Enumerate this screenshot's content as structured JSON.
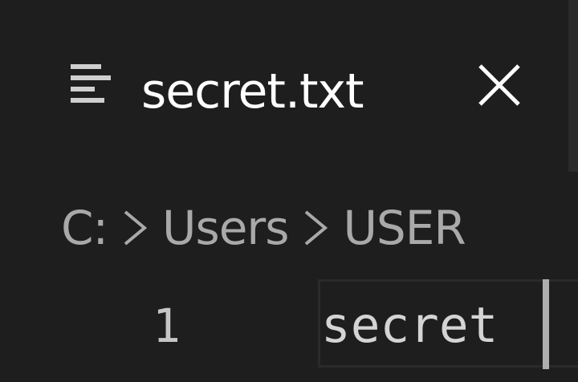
{
  "tab": {
    "icon": "file-lines-icon",
    "title": "secret.txt",
    "close_icon": "close-icon"
  },
  "breadcrumb": {
    "items": [
      "C:",
      "Users",
      "USER"
    ],
    "separator_icon": "chevron-right-icon"
  },
  "editor": {
    "lines": [
      {
        "number": "1",
        "text": "secret"
      }
    ]
  },
  "colors": {
    "background": "#1e1e1e",
    "tab_bar": "#252526",
    "tab_text": "#ffffff",
    "breadcrumb_text": "#a9a9a9",
    "line_number": "#c6c6c6",
    "code_text": "#d4d4d4",
    "caret": "#aeafad"
  }
}
